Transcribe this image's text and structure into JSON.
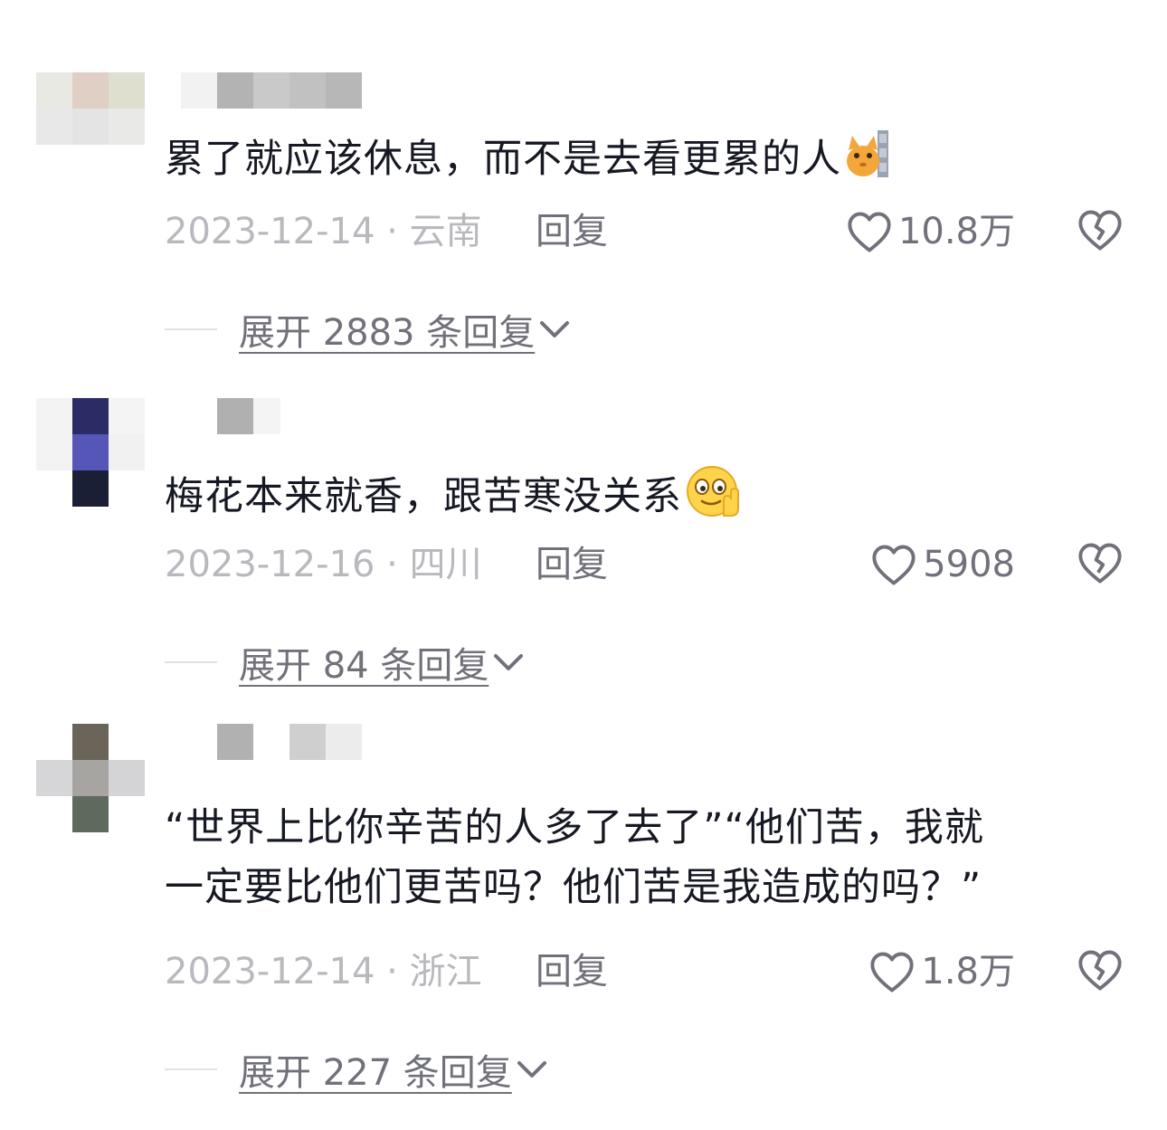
{
  "comments": [
    {
      "text": "累了就应该休息，而不是去看更累的人",
      "emoji": "cat-peek-icon",
      "date_location": "2023-12-14 · 云南",
      "reply_label": "回复",
      "likes": "10.8万",
      "expand_label": "展开 2883 条回复"
    },
    {
      "text": "梅花本来就香，跟苦寒没关系",
      "emoji": "smile-hand-emoji-icon",
      "date_location": "2023-12-16 · 四川",
      "reply_label": "回复",
      "likes": "5908",
      "expand_label": "展开 84 条回复"
    },
    {
      "text_line1": "“世界上比你辛苦的人多了去了”“他们苦，我就",
      "text_line2": "一定要比他们更苦吗？他们苦是我造成的吗？”",
      "date_location": "2023-12-14 · 浙江",
      "reply_label": "回复",
      "likes": "1.8万",
      "expand_label": "展开 227 条回复"
    }
  ],
  "colors": {
    "text": "#161823",
    "meta": "#b8b9be",
    "action": "#70717a"
  },
  "icons": {
    "like": "heart-outline-icon",
    "dislike": "broken-heart-icon",
    "expand": "chevron-down-icon"
  }
}
